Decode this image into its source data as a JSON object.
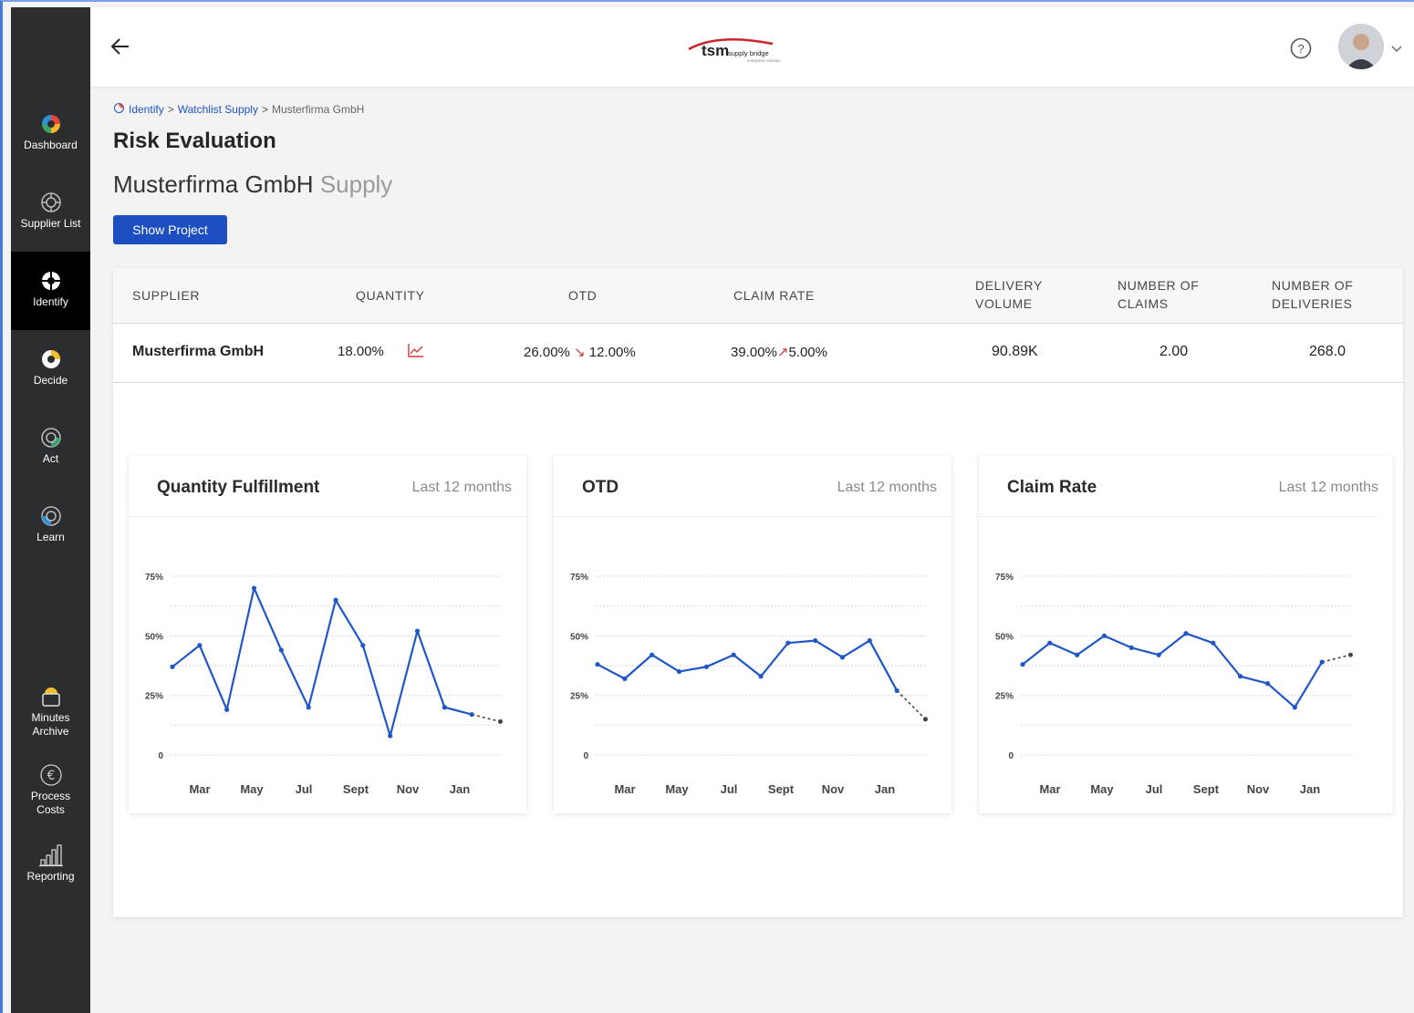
{
  "sidebar": {
    "items": [
      {
        "label": "Dashboard",
        "icon": "dashboard-ring-icon",
        "active": false
      },
      {
        "label": "Supplier List",
        "icon": "supplier-list-ring-icon",
        "active": false
      },
      {
        "label": "Identify",
        "icon": "identify-ring-icon",
        "active": true
      },
      {
        "label": "Decide",
        "icon": "decide-ring-icon",
        "active": false
      },
      {
        "label": "Act",
        "icon": "act-ring-icon",
        "active": false
      },
      {
        "label": "Learn",
        "icon": "learn-ring-icon",
        "active": false
      },
      {
        "label": "Minutes Archive",
        "icon": "minutes-archive-icon",
        "active": false
      },
      {
        "label": "Process Costs",
        "icon": "euro-icon",
        "active": false
      },
      {
        "label": "Reporting",
        "icon": "bar-chart-icon",
        "active": false
      }
    ]
  },
  "header": {
    "logo_text": "tsm",
    "logo_sub": "supply bridge",
    "logo_tagline": "enterprise solution"
  },
  "breadcrumb": {
    "items": [
      "Identify",
      "Watchlist Supply"
    ],
    "separator": ">",
    "current": "Musterfirma GmbH"
  },
  "page": {
    "title": "Risk Evaluation",
    "company": "Musterfirma GmbH",
    "company_suffix": "Supply",
    "show_project_label": "Show Project"
  },
  "table": {
    "headers": {
      "supplier": "SUPPLIER",
      "quantity": "QUANTITY",
      "otd": "OTD",
      "claim_rate": "CLAIM RATE",
      "delivery_volume_1": "DELIVERY",
      "delivery_volume_2": "VOLUME",
      "num_claims_1": "NUMBER OF",
      "num_claims_2": "CLAIMS",
      "num_deliveries_1": "NUMBER OF",
      "num_deliveries_2": "DELIVERIES"
    },
    "row": {
      "supplier": "Musterfirma GmbH",
      "quantity": "18.00%",
      "otd_from": "26.00%",
      "otd_arrow": "↘",
      "otd_to": "12.00%",
      "claim_from": "39.00%",
      "claim_arrow": "↗",
      "claim_to": "5.00%",
      "delivery_volume": "90.89K",
      "num_claims": "2.00",
      "num_deliveries": "268.0"
    }
  },
  "colors": {
    "primary": "#1d4fc3",
    "line": "#1f56c8",
    "projection": "#444444",
    "trend": "#d43a3a"
  },
  "chart_data": [
    {
      "type": "line",
      "title": "Quantity Fulfillment",
      "period": "Last 12 months",
      "x_tick_labels": [
        "Mar",
        "May",
        "Jul",
        "Sept",
        "Nov",
        "Jan"
      ],
      "y_tick_labels": [
        "75%",
        "50%",
        "25%",
        "0"
      ],
      "ylim": [
        0,
        75
      ],
      "grid": true,
      "values": [
        37,
        46,
        19,
        70,
        44,
        20,
        65,
        46,
        8,
        52,
        20,
        17
      ],
      "projection": [
        17,
        14
      ]
    },
    {
      "type": "line",
      "title": "OTD",
      "period": "Last 12 months",
      "x_tick_labels": [
        "Mar",
        "May",
        "Jul",
        "Sept",
        "Nov",
        "Jan"
      ],
      "y_tick_labels": [
        "75%",
        "50%",
        "25%",
        "0"
      ],
      "ylim": [
        0,
        75
      ],
      "grid": true,
      "values": [
        38,
        32,
        42,
        35,
        37,
        42,
        33,
        47,
        48,
        41,
        48,
        27
      ],
      "projection": [
        27,
        15
      ]
    },
    {
      "type": "line",
      "title": "Claim Rate",
      "period": "Last 12 months",
      "x_tick_labels": [
        "Mar",
        "May",
        "Jul",
        "Sept",
        "Nov",
        "Jan"
      ],
      "y_tick_labels": [
        "75%",
        "50%",
        "25%",
        "0"
      ],
      "ylim": [
        0,
        75
      ],
      "grid": true,
      "values": [
        38,
        47,
        42,
        50,
        45,
        42,
        51,
        47,
        33,
        30,
        20,
        39
      ],
      "projection": [
        39,
        42
      ]
    }
  ]
}
